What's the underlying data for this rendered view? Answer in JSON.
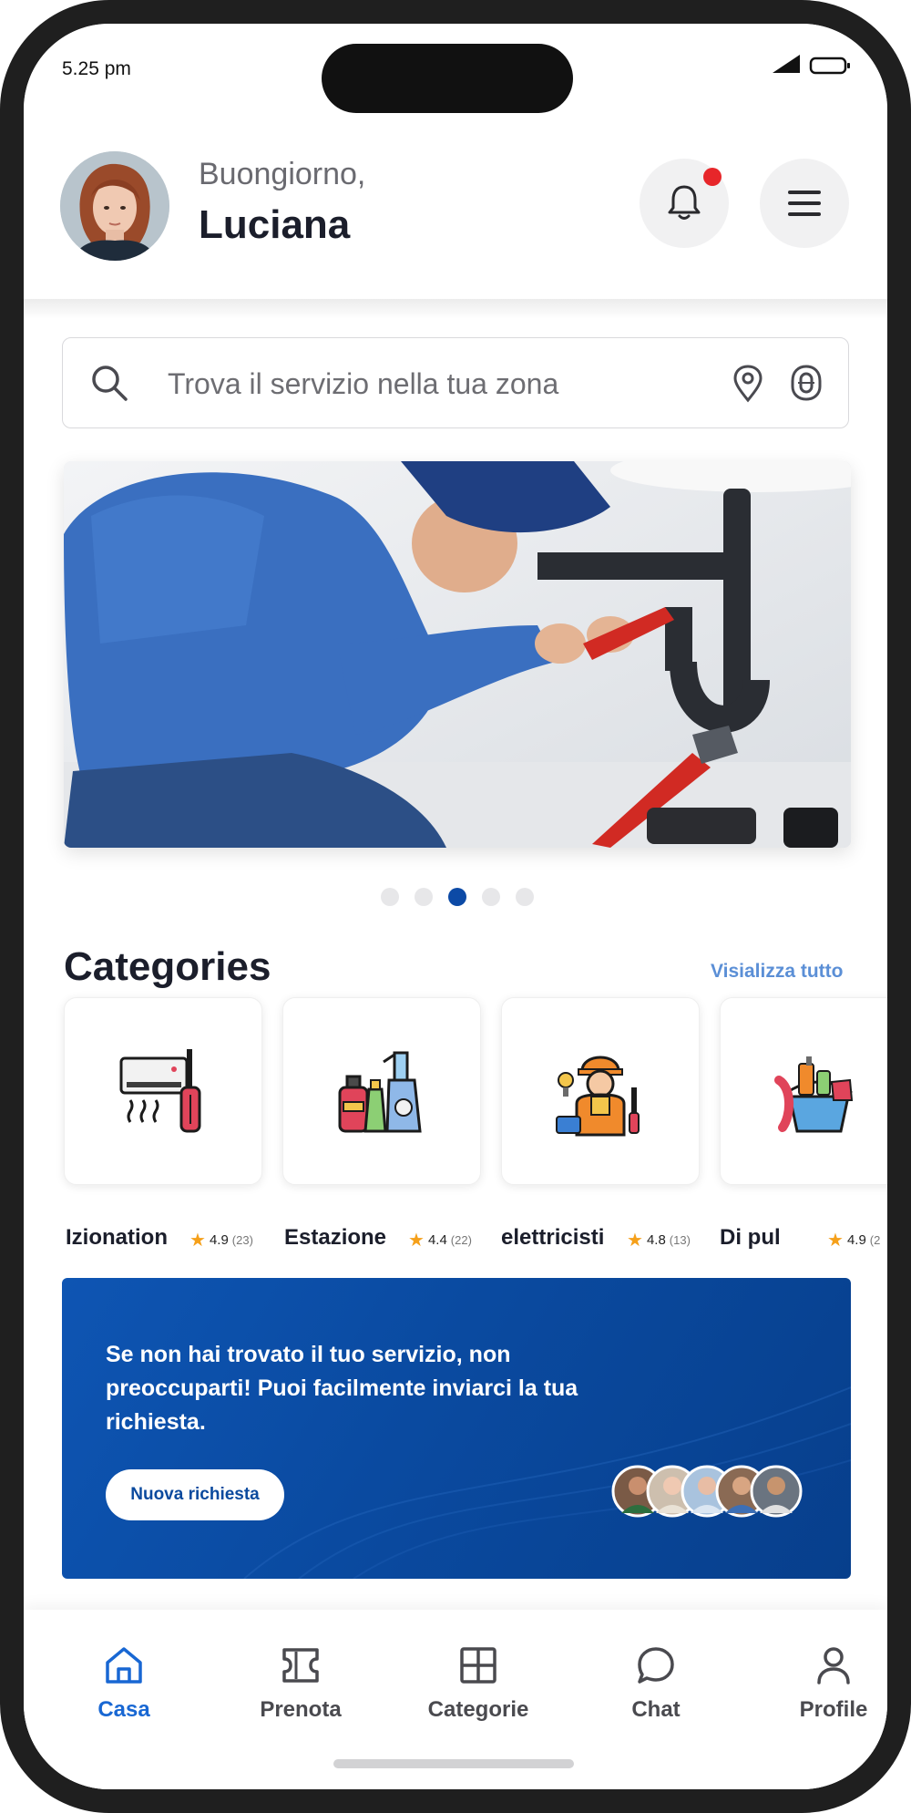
{
  "status_bar": {
    "time": "5.25 pm"
  },
  "header": {
    "greeting": "Buongiorno,",
    "user_name": "Luciana"
  },
  "search": {
    "placeholder": "Trova il servizio nella tua zona"
  },
  "carousel": {
    "total_slides": 5,
    "active_slide": 3
  },
  "categories": {
    "title": "Categories",
    "view_all": "Visializza tutto",
    "items": [
      {
        "name": "Izionation",
        "rating": "4.9",
        "count": "(23)",
        "icon": "air-conditioner-repair-icon"
      },
      {
        "name": "Estazione",
        "rating": "4.4",
        "count": "(22)",
        "icon": "cleaning-products-icon"
      },
      {
        "name": "elettricisti",
        "rating": "4.8",
        "count": "(13)",
        "icon": "electrician-worker-icon"
      },
      {
        "name": "Di pul",
        "rating": "4.9",
        "count": "(2",
        "icon": "cleaning-bucket-icon"
      }
    ]
  },
  "promo": {
    "text": "Se non hai trovato il tuo servizio, non preoccuparti! Puoi facilmente inviarci la tua richiesta.",
    "button": "Nuova richiesta"
  },
  "bottom_nav": {
    "items": [
      {
        "label": "Casa",
        "icon": "home-icon",
        "active": true
      },
      {
        "label": "Prenota",
        "icon": "ticket-icon",
        "active": false
      },
      {
        "label": "Categorie",
        "icon": "grid-icon",
        "active": false
      },
      {
        "label": "Chat",
        "icon": "chat-icon",
        "active": false
      },
      {
        "label": "Profile",
        "icon": "user-icon",
        "active": false
      }
    ]
  },
  "colors": {
    "accent": "#1867d3",
    "promo_bg": "#0a4aa0",
    "notification": "#e7262a",
    "star": "#f5a01a"
  }
}
